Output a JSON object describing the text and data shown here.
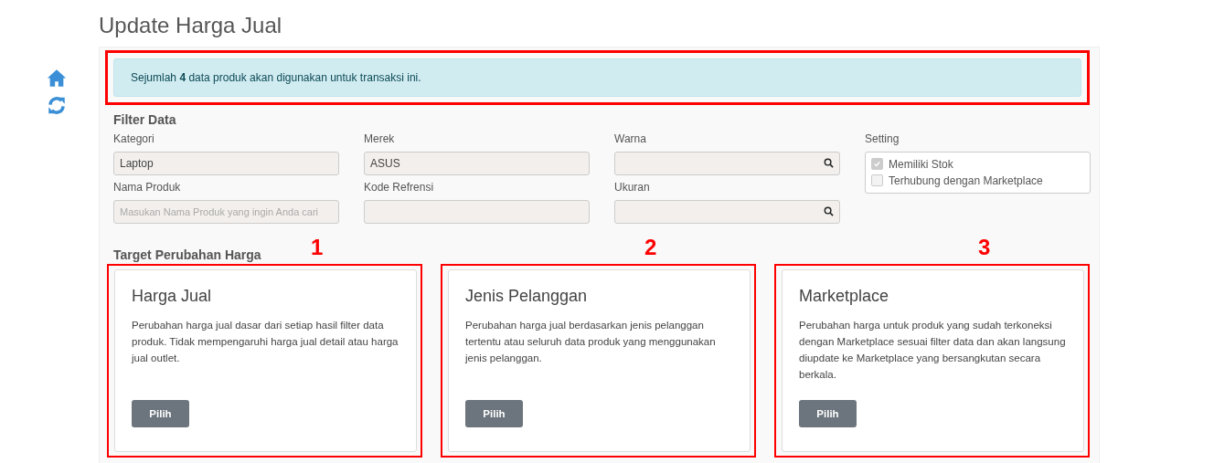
{
  "page_title": "Update Harga Jual",
  "side_icons": [
    {
      "kind": "home"
    },
    {
      "kind": "refresh"
    }
  ],
  "alert": {
    "text": "Sejumlah **4** data produk akan digunakan untuk transaksi ini."
  },
  "filter": {
    "title": "Filter Data",
    "fields": [
      {
        "label": "Kategori",
        "value": "Laptop",
        "kind": "text"
      },
      {
        "label": "Merek",
        "value": "ASUS",
        "kind": "text"
      },
      {
        "label": "Warna",
        "kind": "search"
      },
      {
        "label": "Nama Produk",
        "placeholder": "Masukan Nama Produk yang ingin Anda cari",
        "kind": "text"
      },
      {
        "label": "Kode Refrensi",
        "kind": "text"
      },
      {
        "label": "Ukuran",
        "kind": "search"
      }
    ],
    "setting": {
      "label": "Setting",
      "options": [
        {
          "label": "Memiliki Stok",
          "checked": true
        },
        {
          "label": "Terhubung dengan Marketplace",
          "checked": false
        }
      ]
    }
  },
  "target": {
    "title": "Target Perubahan Harga",
    "cards": [
      {
        "marker": "1",
        "title": "Harga Jual",
        "description": "Perubahan harga jual dasar dari setiap hasil filter data produk. Tidak mempengaruhi harga jual detail atau harga jual outlet.",
        "button": "Pilih"
      },
      {
        "marker": "2",
        "title": "Jenis Pelanggan",
        "description": "Perubahan harga jual berdasarkan jenis pelanggan tertentu atau seluruh data produk yang menggunakan jenis pelanggan.",
        "button": "Pilih"
      },
      {
        "marker": "3",
        "title": "Marketplace",
        "description": "Perubahan harga untuk produk yang sudah terkoneksi dengan Marketplace sesuai filter data dan akan langsung diupdate ke Marketplace yang bersangkutan secara berkala.",
        "button": "Pilih"
      }
    ]
  }
}
